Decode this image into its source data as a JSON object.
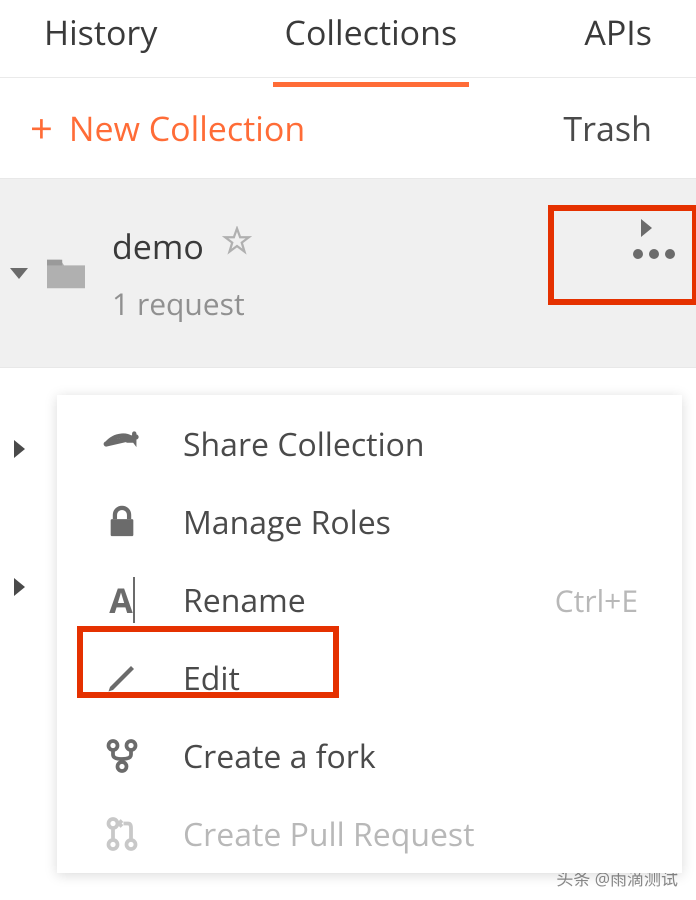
{
  "tabs": {
    "history": "History",
    "collections": "Collections",
    "apis": "APIs"
  },
  "toolbar": {
    "new_collection": "New Collection",
    "trash": "Trash"
  },
  "collection": {
    "name": "demo",
    "meta": "1 request"
  },
  "menu": {
    "share": "Share Collection",
    "manage_roles": "Manage Roles",
    "rename": "Rename",
    "rename_shortcut": "Ctrl+E",
    "edit": "Edit",
    "fork": "Create a fork",
    "pull_request": "Create Pull Request"
  },
  "watermark": "头条 @雨滴测试"
}
